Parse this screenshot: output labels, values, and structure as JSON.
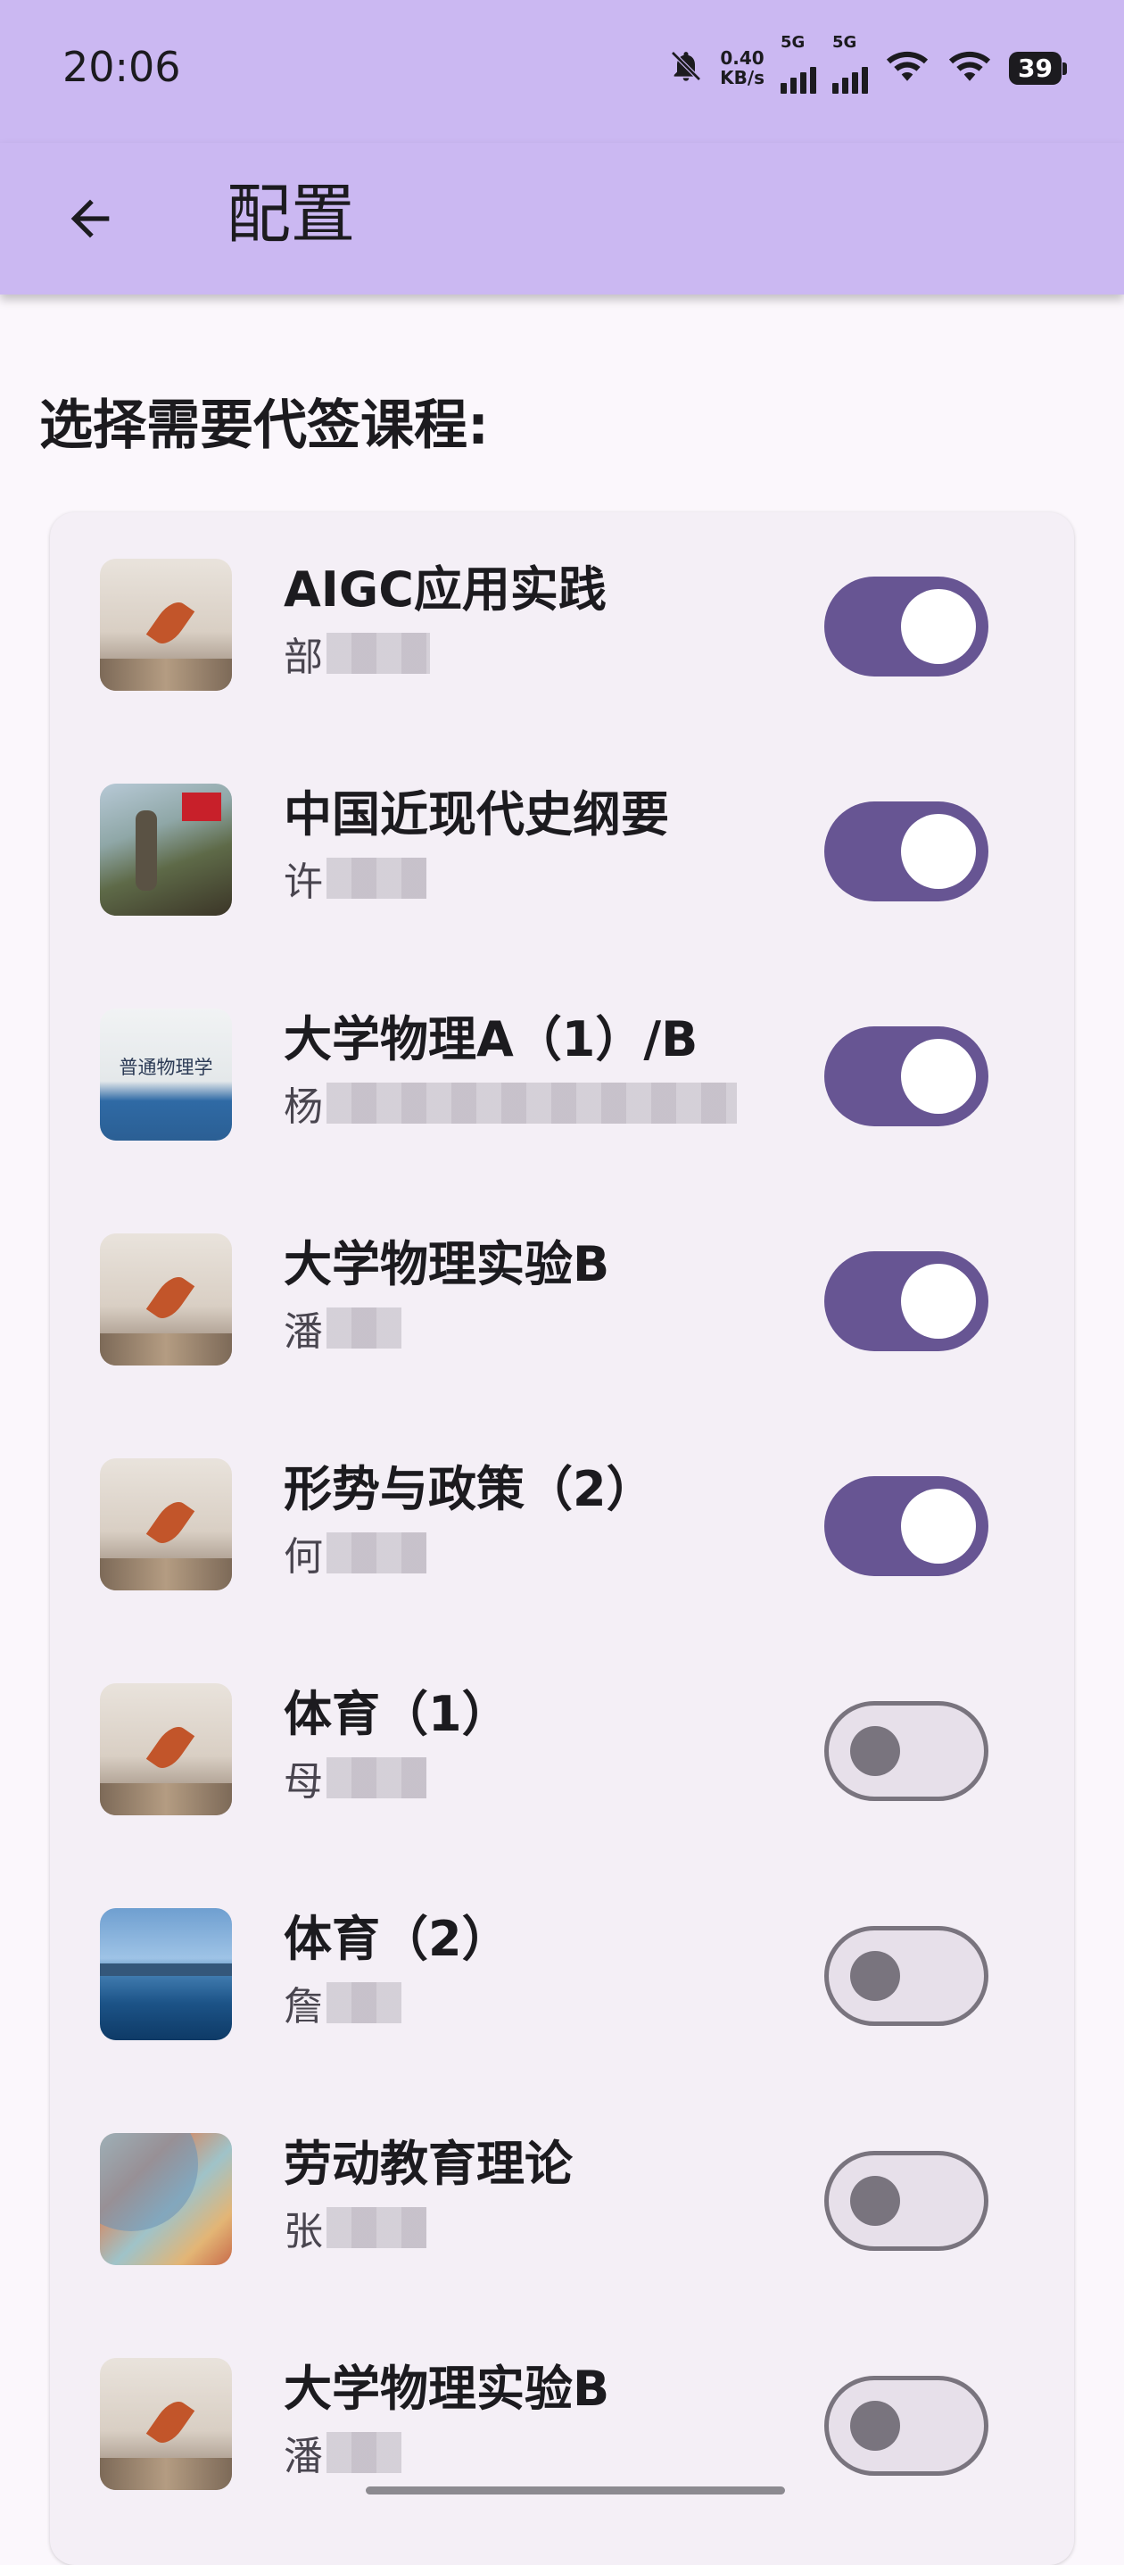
{
  "status_bar": {
    "time": "20:06",
    "net_speed_value": "0.40",
    "net_speed_unit": "KB/s",
    "signal_1": "5G",
    "signal_2": "5G",
    "battery": "39"
  },
  "app_bar": {
    "title": "配置"
  },
  "section": {
    "title": "选择需要代签课程:"
  },
  "courses": [
    {
      "name": "AIGC应用实践",
      "teacher": "部",
      "image": "falling-leaf",
      "enabled": true
    },
    {
      "name": "中国近现代史纲要",
      "teacher": "许",
      "image": "historical-painting",
      "enabled": true
    },
    {
      "name": "大学物理A（1）/B",
      "teacher": "杨",
      "image": "physics-book-cover",
      "enabled": true
    },
    {
      "name": "大学物理实验B",
      "teacher": "潘",
      "image": "falling-leaf",
      "enabled": true
    },
    {
      "name": "形势与政策（2）",
      "teacher": "何",
      "image": "falling-leaf",
      "enabled": true
    },
    {
      "name": "体育（1）",
      "teacher": "母",
      "image": "falling-leaf",
      "enabled": false
    },
    {
      "name": "体育（2）",
      "teacher": "詹",
      "image": "lake-landscape",
      "enabled": false
    },
    {
      "name": "劳动教育理论",
      "teacher": "张",
      "image": "illustrated-map",
      "enabled": false
    },
    {
      "name": "大学物理实验B",
      "teacher": "潘",
      "image": "falling-leaf",
      "enabled": false
    }
  ],
  "book_cover_text": "普通物理学",
  "colors": {
    "app_bar": "#cbb8f2",
    "switch_on": "#675593",
    "switch_off_track": "#e7e0ea",
    "switch_off_border": "#79747e",
    "background": "#fbf7fc",
    "card": "#f4eff6"
  }
}
